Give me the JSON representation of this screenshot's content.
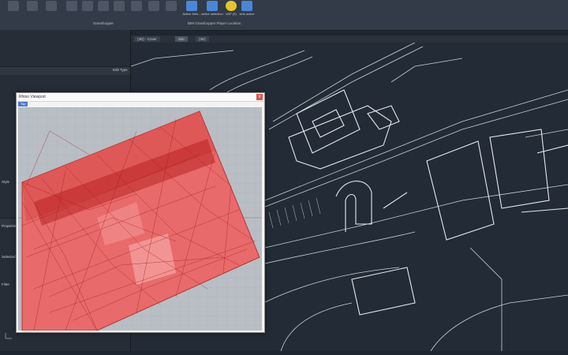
{
  "ribbon": {
    "buttons": [
      {
        "label": "",
        "icon": "tool-icon"
      },
      {
        "label": "",
        "icon": "tool-icon"
      },
      {
        "label": "",
        "icon": "tool-icon"
      },
      {
        "label": "",
        "icon": "tool-icon"
      },
      {
        "label": "",
        "icon": "tool-icon"
      },
      {
        "label": "",
        "icon": "tool-icon"
      },
      {
        "label": "",
        "icon": "tool-icon"
      },
      {
        "label": "",
        "icon": "tool-icon"
      },
      {
        "label": "",
        "icon": "tool-icon"
      },
      {
        "label": "",
        "icon": "tool-icon"
      },
      {
        "label": "",
        "icon": "tool-icon"
      },
      {
        "label": "Active Sele...",
        "icon": "select-icon"
      },
      {
        "label": "active selection",
        "icon": "select-icon"
      },
      {
        "label": "WIP (9)",
        "icon": "player-icon"
      },
      {
        "label": "sets active",
        "icon": "player-icon"
      }
    ],
    "panels": [
      {
        "label": "Grasshopper"
      },
      {
        "label": "BIM Grasshopper Player Location"
      }
    ]
  },
  "left_panel": {
    "header": "Edit Type",
    "rows": [
      "Style",
      "Properties",
      "Selected",
      "Filter"
    ]
  },
  "tabs": [
    {
      "label": "{3D} - Cover"
    },
    {
      "label": "Site"
    },
    {
      "label": "{3D}"
    }
  ],
  "rhino": {
    "title": "Rhino Viewport",
    "close": "x",
    "tab": "Top"
  }
}
